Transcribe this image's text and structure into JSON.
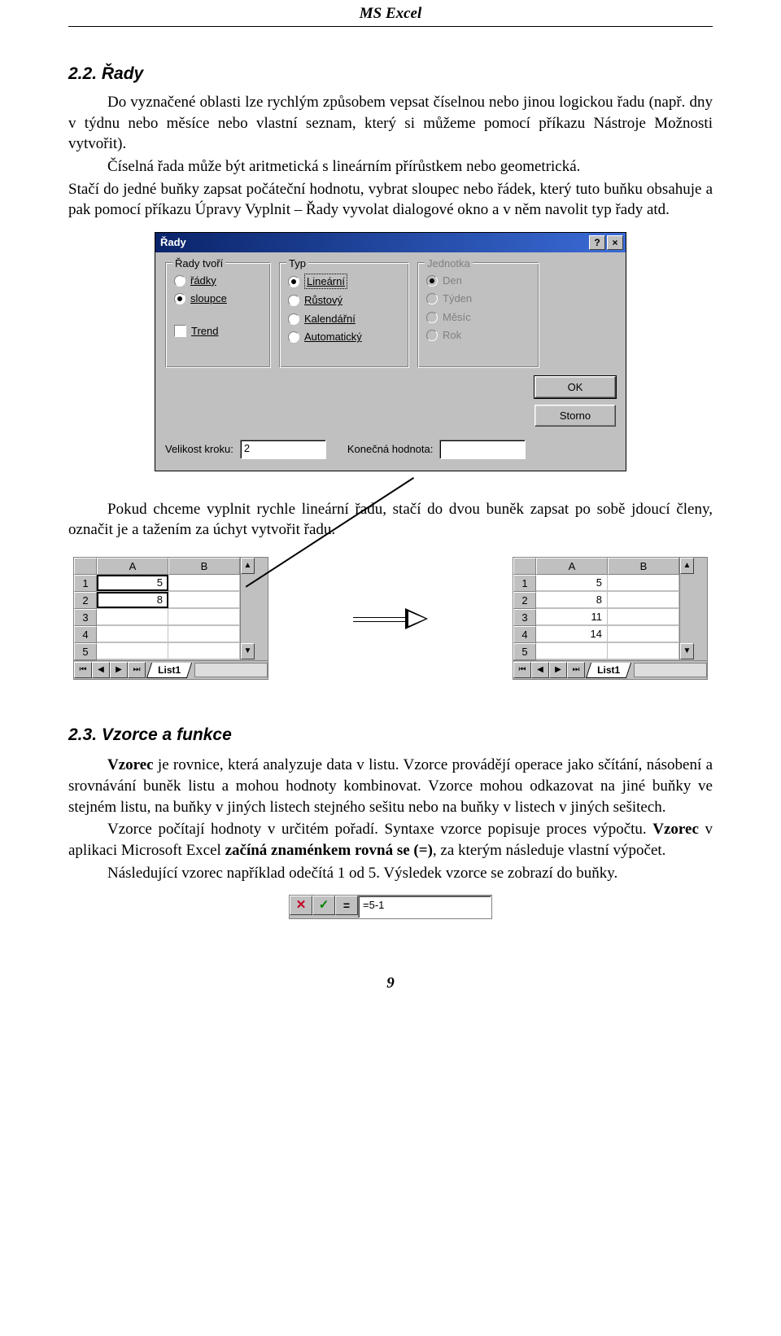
{
  "header": "MS Excel",
  "sec1": {
    "title": "2.2. Řady",
    "p1": "Do vyznačené oblasti lze rychlým způsobem vepsat číselnou nebo jinou logickou řadu (např. dny v týdnu nebo měsíce nebo vlastní seznam, který si můžeme pomocí příkazu Nástroje Možnosti vytvořit).",
    "p2": "Číselná řada může být aritmetická s lineárním přírůstkem nebo geometrická.",
    "p3": "Stačí do jedné buňky zapsat počáteční hodnotu, vybrat sloupec nebo řádek, který tuto buňku obsahuje a pak pomocí příkazu Úpravy Vyplnit – Řady vyvolat dialogové okno a v něm navolit typ řady atd.",
    "p4": "Pokud chceme vyplnit rychle lineární řadu, stačí do dvou buněk zapsat po sobě jdoucí členy, označit je a tažením za úchyt vytvořit řadu."
  },
  "dialog": {
    "title": "Řady",
    "help": "?",
    "close": "×",
    "g1": {
      "title": "Řady tvoří",
      "r1": "řádky",
      "r2": "sloupce"
    },
    "g2": {
      "title": "Typ",
      "r1": "Lineární",
      "r2": "Růstový",
      "r3": "Kalendářní",
      "r4": "Automatický"
    },
    "g3": {
      "title": "Jednotka",
      "r1": "Den",
      "r2": "Týden",
      "r3": "Měsíc",
      "r4": "Rok"
    },
    "trend": "Trend",
    "step_lbl": "Velikost kroku:",
    "step_val": "2",
    "end_lbl": "Konečná hodnota:",
    "ok": "OK",
    "cancel": "Storno"
  },
  "ss": {
    "colA": "A",
    "colB": "B",
    "rows": [
      "1",
      "2",
      "3",
      "4",
      "5"
    ],
    "left": {
      "a1": "5",
      "a2": "8",
      "a3": "",
      "a4": ""
    },
    "right": {
      "a1": "5",
      "a2": "8",
      "a3": "11",
      "a4": "14"
    },
    "tab": "List1"
  },
  "sec2": {
    "title": "2.3. Vzorce a funkce",
    "p1a": "Vzorec",
    "p1b": " je rovnice, která analyzuje data v listu. Vzorce provádějí operace jako sčítání, násobení a srovnávání buněk listu a mohou hodnoty kombinovat. Vzorce mohou odkazovat na jiné buňky ve stejném listu, na buňky v jiných listech stejného sešitu nebo na buňky v listech v jiných sešitech.",
    "p2a": "Vzorce počítají hodnoty v určitém pořadí. Syntaxe vzorce popisuje proces výpočtu. ",
    "p2b": "Vzorec",
    "p2c": " v aplikaci Microsoft Excel ",
    "p2d": "začíná znaménkem rovná se (=)",
    "p2e": ", za kterým následuje vlastní výpočet.",
    "p3": "Následující vzorec například odečítá 1 od 5. Výsledek vzorce se zobrazí do buňky."
  },
  "formula": "=5-1",
  "pagenum": "9"
}
